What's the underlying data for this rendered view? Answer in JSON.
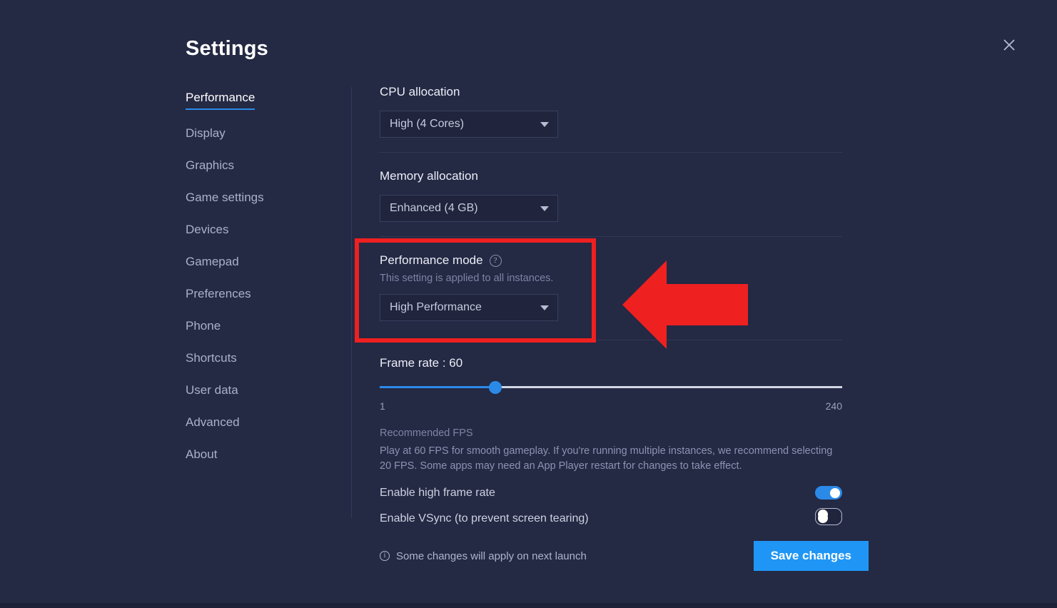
{
  "window": {
    "title": "Settings",
    "close_icon": "close-icon"
  },
  "sidebar": {
    "items": [
      {
        "label": "Performance",
        "active": true
      },
      {
        "label": "Display",
        "active": false
      },
      {
        "label": "Graphics",
        "active": false
      },
      {
        "label": "Game settings",
        "active": false
      },
      {
        "label": "Devices",
        "active": false
      },
      {
        "label": "Gamepad",
        "active": false
      },
      {
        "label": "Preferences",
        "active": false
      },
      {
        "label": "Phone",
        "active": false
      },
      {
        "label": "Shortcuts",
        "active": false
      },
      {
        "label": "User data",
        "active": false
      },
      {
        "label": "Advanced",
        "active": false
      },
      {
        "label": "About",
        "active": false
      }
    ]
  },
  "main": {
    "cpu": {
      "label": "CPU allocation",
      "value": "High (4 Cores)"
    },
    "memory": {
      "label": "Memory allocation",
      "value": "Enhanced (4 GB)"
    },
    "performance_mode": {
      "label": "Performance mode",
      "help_icon": "help-circle-icon",
      "description": "This setting is applied to all instances.",
      "value": "High Performance",
      "highlighted": true,
      "highlight_color": "#ef2020"
    },
    "frame_rate": {
      "label": "Frame rate : 60",
      "value": 60,
      "min_label": "1",
      "max_label": "240",
      "min": 1,
      "max": 240,
      "recommendation_title": "Recommended FPS",
      "recommendation_body": "Play at 60 FPS for smooth gameplay. If you're running multiple instances, we recommend selecting 20 FPS. Some apps may need an App Player restart for changes to take effect."
    },
    "toggles": [
      {
        "label": "Enable high frame rate",
        "on": true
      },
      {
        "label": "Enable VSync (to prevent screen tearing)",
        "on": false
      }
    ],
    "clipped_toggle": {
      "label": "",
      "on": false
    }
  },
  "footer": {
    "note": "Some changes will apply on next launch",
    "info_icon": "info-circle-icon",
    "save_label": "Save changes"
  },
  "annotations": {
    "arrow": {
      "name": "red-left-arrow",
      "color": "#ef2020",
      "direction": "left"
    }
  },
  "colors": {
    "background": "#242944",
    "accent": "#2b8ae8",
    "save_button": "#1f96f5",
    "highlight": "#ef2020",
    "field_bg": "#20243c"
  }
}
